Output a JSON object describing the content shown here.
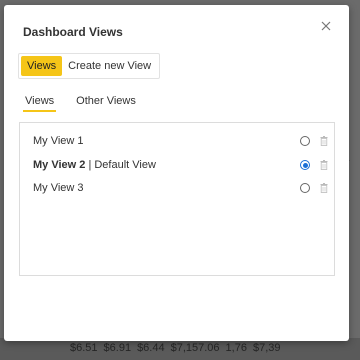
{
  "background": {
    "values": [
      "$6.51",
      "$6.91",
      "$6.44",
      "$7,157.06",
      "1,76",
      "$7,39"
    ],
    "glyph": "TL"
  },
  "modal": {
    "title": "Dashboard Views",
    "close_icon": "close-icon",
    "tabs": [
      {
        "label": "Views",
        "active": true
      },
      {
        "label": "Create new View",
        "active": false
      }
    ],
    "sub_tabs": [
      {
        "label": "Views",
        "active": true
      },
      {
        "label": "Other Views",
        "active": false
      }
    ],
    "views": [
      {
        "name": "My View 1",
        "suffix": "",
        "selected": false
      },
      {
        "name": "My View 2",
        "suffix": " | Default View",
        "selected": true
      },
      {
        "name": "My View 3",
        "suffix": "",
        "selected": false
      }
    ]
  },
  "colors": {
    "accent": "#f5c518",
    "radio_selected": "#1a6fd6"
  }
}
